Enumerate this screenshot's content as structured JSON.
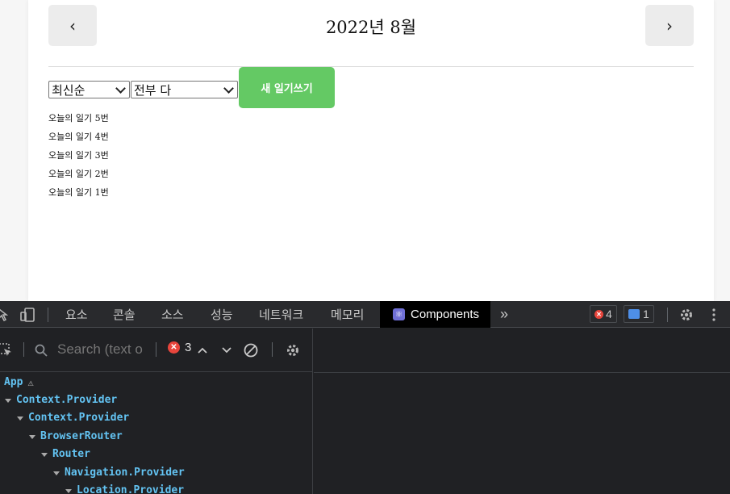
{
  "app": {
    "header": {
      "prev_label": "‹",
      "title": "2022년 8월",
      "next_label": "›"
    },
    "controls": {
      "sort_selected": "최신순",
      "filter_selected": "전부 다",
      "new_button_label": "새 일기쓰기"
    },
    "diaries": [
      "오늘의 일기 5번",
      "오늘의 일기 4번",
      "오늘의 일기 3번",
      "오늘의 일기 2번",
      "오늘의 일기 1번"
    ],
    "colors": {
      "accent_green": "#64c964",
      "header_button_bg": "#ececec"
    }
  },
  "devtools": {
    "tabs": [
      "요소",
      "콘솔",
      "소스",
      "성능",
      "네트워크",
      "메모리",
      "Components"
    ],
    "active_tab": "Components",
    "more_tabs_label": "»",
    "error_badge_count": "4",
    "message_badge_count": "1",
    "search_placeholder": "Search (text o",
    "component_error_count": "3",
    "tree": [
      {
        "label": "App",
        "warning": true
      },
      {
        "label": "Context.Provider"
      },
      {
        "label": "Context.Provider"
      },
      {
        "label": "BrowserRouter"
      },
      {
        "label": "Router"
      },
      {
        "label": "Navigation.Provider"
      },
      {
        "label": "Location.Provider"
      }
    ],
    "icons": [
      "inspect-icon",
      "device-toggle-icon",
      "gear-icon",
      "kebab-menu-icon",
      "select-element-icon",
      "search-icon",
      "chevron-up-icon",
      "chevron-down-icon",
      "clear-icon",
      "settings-gear-icon",
      "warning-icon"
    ],
    "colors": {
      "panel_bg": "#202124",
      "tree_text": "#63c3f2",
      "error_red": "#e8453c"
    }
  }
}
